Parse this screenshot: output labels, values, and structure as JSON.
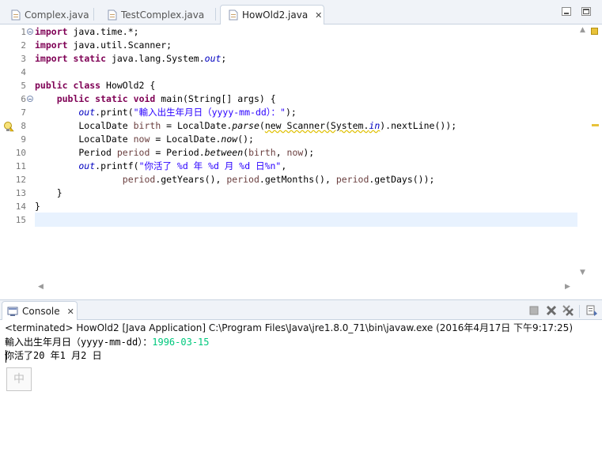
{
  "editor_tabs": [
    {
      "label": "Complex.java",
      "active": false
    },
    {
      "label": "TestComplex.java",
      "active": false
    },
    {
      "label": "HowOld2.java",
      "active": true
    }
  ],
  "editor": {
    "line_numbers": [
      "1",
      "2",
      "3",
      "4",
      "5",
      "6",
      "7",
      "8",
      "9",
      "10",
      "11",
      "12",
      "13",
      "14",
      "15"
    ],
    "lines": [
      {
        "k1": "import",
        "t1": " java.time.*;"
      },
      {
        "k1": "import",
        "t1": " java.util.Scanner;"
      },
      {
        "k1": "import",
        "k2": " static",
        "t1": " java.lang.System.",
        "f1": "out",
        "t2": ";"
      },
      {},
      {
        "k1": "public",
        "k2": " class",
        "t1": " HowOld2 {"
      },
      {
        "k1": "    public",
        "k2": " static",
        "k3": " void",
        "t1": " main(String[] args) {"
      },
      {
        "f1": "        out",
        "t1": ".print(",
        "s1": "\"輸入出生年月日（yyyy-mm-dd）：\"",
        "t2": ");"
      },
      {
        "t1": "        LocalDate ",
        "v1": "birth",
        "t2": " = LocalDate.",
        "i1": "parse",
        "t3": "(",
        "w1": "new Scanner(System.",
        "wf": "in",
        "t4": ").nextLine());"
      },
      {
        "t1": "        LocalDate ",
        "v1": "now",
        "t2": " = LocalDate.",
        "i1": "now",
        "t3": "();"
      },
      {
        "t1": "        Period ",
        "v1": "period",
        "t2": " = Period.",
        "i1": "between",
        "t3": "(",
        "v2": "birth",
        "t4": ", ",
        "v3": "now",
        "t5": ");"
      },
      {
        "f1": "        out",
        "t1": ".printf(",
        "s1": "\"你活了 %d 年 %d 月 %d 日%n\"",
        "t2": ","
      },
      {
        "v1": "                period",
        "t1": ".getYears(), ",
        "v2": "period",
        "t2": ".getMonths(), ",
        "v3": "period",
        "t3": ".getDays());"
      },
      {
        "t1": "    }"
      },
      {
        "t1": "}"
      },
      {}
    ]
  },
  "console": {
    "tab_label": "Console",
    "status": "<terminated> HowOld2 [Java Application] C:\\Program Files\\Java\\jre1.8.0_71\\bin\\javaw.exe (2016年4月17日 下午9:17:25)",
    "prompt": "輸入出生年月日（yyyy-mm-dd）：",
    "input": "1996-03-15",
    "result": "你活了20 年1 月2 日",
    "ime_char": "中"
  },
  "colors": {
    "keyword": "#7f0055",
    "string": "#2a00ff",
    "field": "#0000c0",
    "console_input": "#00c87d",
    "current_line": "#e8f2fe"
  },
  "icons": [
    "java-file-icon",
    "close-icon",
    "minimize-icon",
    "maximize-icon",
    "warning-lightbulb-icon",
    "console-icon",
    "terminate-icon",
    "remove-launch-icon",
    "remove-all-terminated-icon",
    "display-console-icon"
  ]
}
